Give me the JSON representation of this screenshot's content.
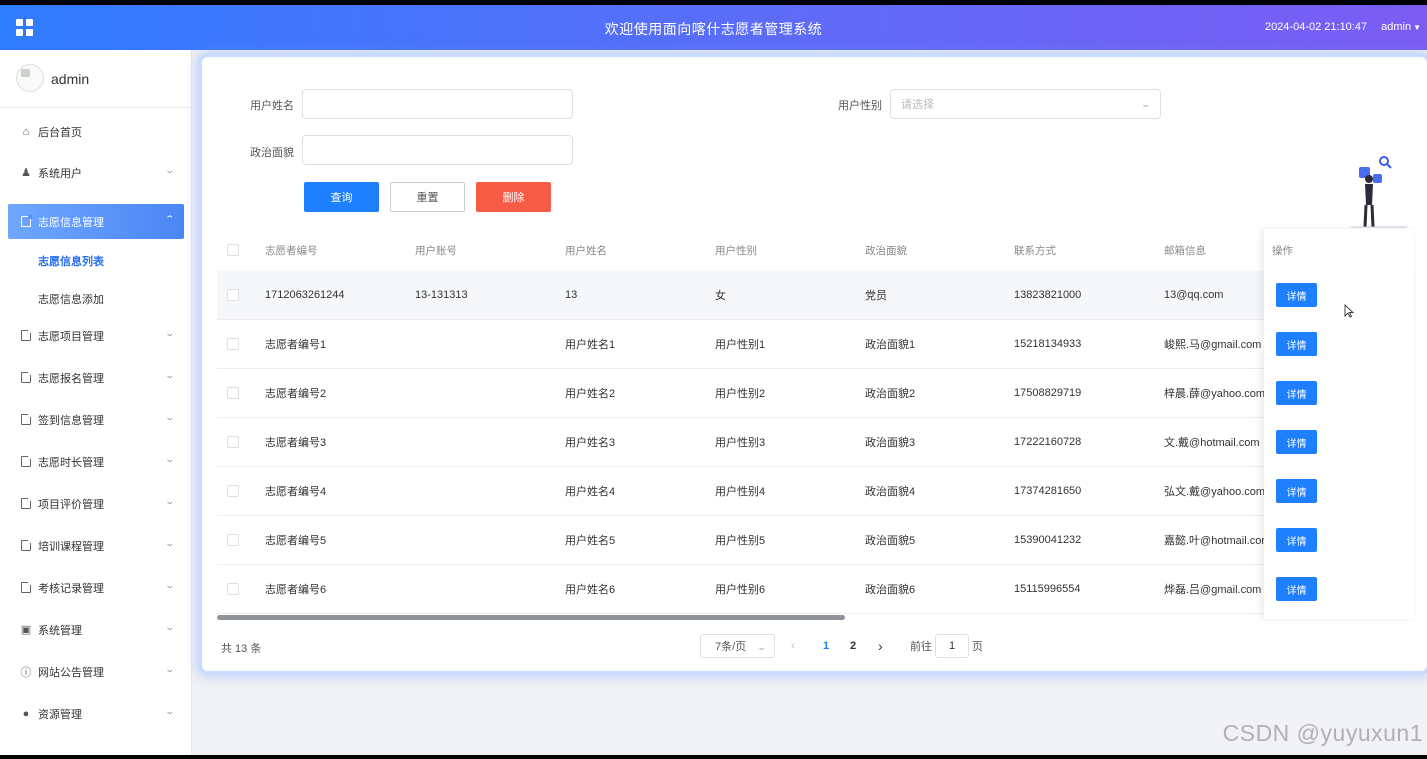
{
  "header": {
    "title": "欢迎使用面向喀什志愿者管理系统",
    "datetime": "2024-04-02 21:10:47",
    "user": "admin"
  },
  "sidebar": {
    "profile_name": "admin",
    "items": [
      {
        "label": "后台首页",
        "icon": "home-icon"
      },
      {
        "label": "系统用户",
        "icon": "user-icon"
      },
      {
        "label": "志愿信息管理",
        "icon": "document-icon",
        "active": true
      },
      {
        "label": "志愿项目管理",
        "icon": "document-icon"
      },
      {
        "label": "志愿报名管理",
        "icon": "document-icon"
      },
      {
        "label": "签到信息管理",
        "icon": "document-icon"
      },
      {
        "label": "志愿时长管理",
        "icon": "document-icon"
      },
      {
        "label": "项目评价管理",
        "icon": "document-icon"
      },
      {
        "label": "培训课程管理",
        "icon": "document-icon"
      },
      {
        "label": "考核记录管理",
        "icon": "document-icon"
      },
      {
        "label": "系统管理",
        "icon": "image-icon"
      },
      {
        "label": "网站公告管理",
        "icon": "info-icon"
      },
      {
        "label": "资源管理",
        "icon": "location-icon"
      }
    ],
    "sub_items": [
      "志愿信息列表",
      "志愿信息添加"
    ]
  },
  "search": {
    "name_label": "用户姓名",
    "gender_label": "用户性别",
    "gender_placeholder": "请选择",
    "politics_label": "政治面貌",
    "query_button": "查询",
    "reset_button": "重置",
    "delete_button": "删除"
  },
  "table": {
    "columns": [
      "志愿者编号",
      "用户账号",
      "用户姓名",
      "用户性别",
      "政治面貌",
      "联系方式",
      "邮箱信息"
    ],
    "action_header": "操作",
    "action_label": "详情",
    "rows": [
      [
        "1712063261244",
        "13-131313",
        "13",
        "女",
        "党员",
        "13823821000",
        "13@qq.com"
      ],
      [
        "志愿者编号1",
        "",
        "用户姓名1",
        "用户性别1",
        "政治面貌1",
        "15218134933",
        "峻熙.马@gmail.com"
      ],
      [
        "志愿者编号2",
        "",
        "用户姓名2",
        "用户性别2",
        "政治面貌2",
        "17508829719",
        "梓晨.薛@yahoo.com"
      ],
      [
        "志愿者编号3",
        "",
        "用户姓名3",
        "用户性别3",
        "政治面貌3",
        "17222160728",
        "文.戴@hotmail.com"
      ],
      [
        "志愿者编号4",
        "",
        "用户姓名4",
        "用户性别4",
        "政治面貌4",
        "17374281650",
        "弘文.戴@yahoo.com"
      ],
      [
        "志愿者编号5",
        "",
        "用户姓名5",
        "用户性别5",
        "政治面貌5",
        "15390041232",
        "嘉懿.叶@hotmail.com"
      ],
      [
        "志愿者编号6",
        "",
        "用户姓名6",
        "用户性别6",
        "政治面貌6",
        "15115996554",
        "烨磊.吕@gmail.com"
      ]
    ]
  },
  "pagination": {
    "total": "共 13 条",
    "page_size": "7条/页",
    "pages": [
      "1",
      "2"
    ],
    "current_page": "1",
    "goto_label": "前往",
    "goto_value": "1",
    "goto_suffix": "页"
  },
  "watermark": "CSDN @yuyuxun1",
  "colors": {
    "header_gradient_start": "#2f7cff",
    "header_gradient_end": "#7b5cf3",
    "primary": "#1e80ff",
    "danger": "#f55b45",
    "active_menu": "#5a92f7"
  }
}
